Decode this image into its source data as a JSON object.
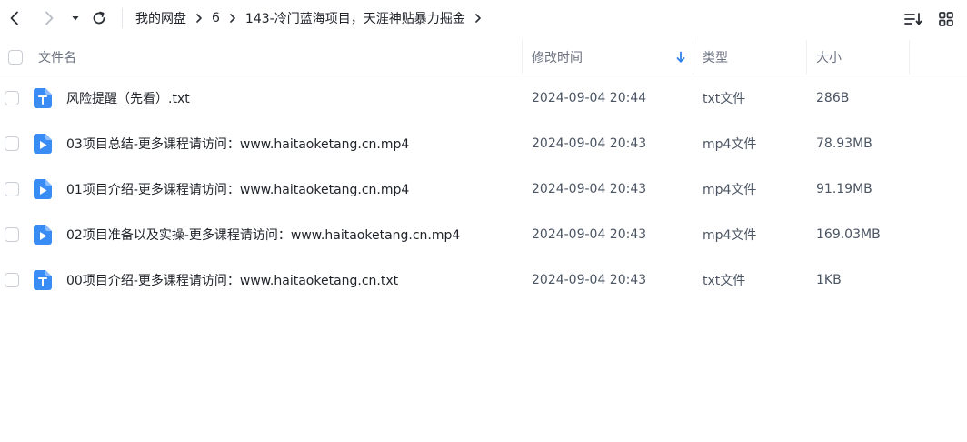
{
  "breadcrumb": {
    "items": [
      "我的网盘",
      "6",
      "143-冷门蓝海项目，天涯神贴暴力掘金"
    ]
  },
  "columns": {
    "name": "文件名",
    "modified": "修改时间",
    "type": "类型",
    "size": "大小"
  },
  "files": [
    {
      "name": "风险提醒（先看）.txt",
      "modified": "2024-09-04 20:44",
      "type": "txt文件",
      "size": "286B",
      "icon": "text-file-icon"
    },
    {
      "name": "03项目总结-更多课程请访问：www.haitaoketang.cn.mp4",
      "modified": "2024-09-04 20:43",
      "type": "mp4文件",
      "size": "78.93MB",
      "icon": "video-file-icon"
    },
    {
      "name": "01项目介绍-更多课程请访问：www.haitaoketang.cn.mp4",
      "modified": "2024-09-04 20:43",
      "type": "mp4文件",
      "size": "91.19MB",
      "icon": "video-file-icon"
    },
    {
      "name": "02项目准备以及实操-更多课程请访问：www.haitaoketang.cn.mp4",
      "modified": "2024-09-04 20:43",
      "type": "mp4文件",
      "size": "169.03MB",
      "icon": "video-file-icon"
    },
    {
      "name": "00项目介绍-更多课程请访问：www.haitaoketang.cn.txt",
      "modified": "2024-09-04 20:43",
      "type": "txt文件",
      "size": "1KB",
      "icon": "text-file-icon"
    }
  ],
  "colors": {
    "accent": "#2f80ed",
    "file_icon": "#3a8cf5"
  }
}
